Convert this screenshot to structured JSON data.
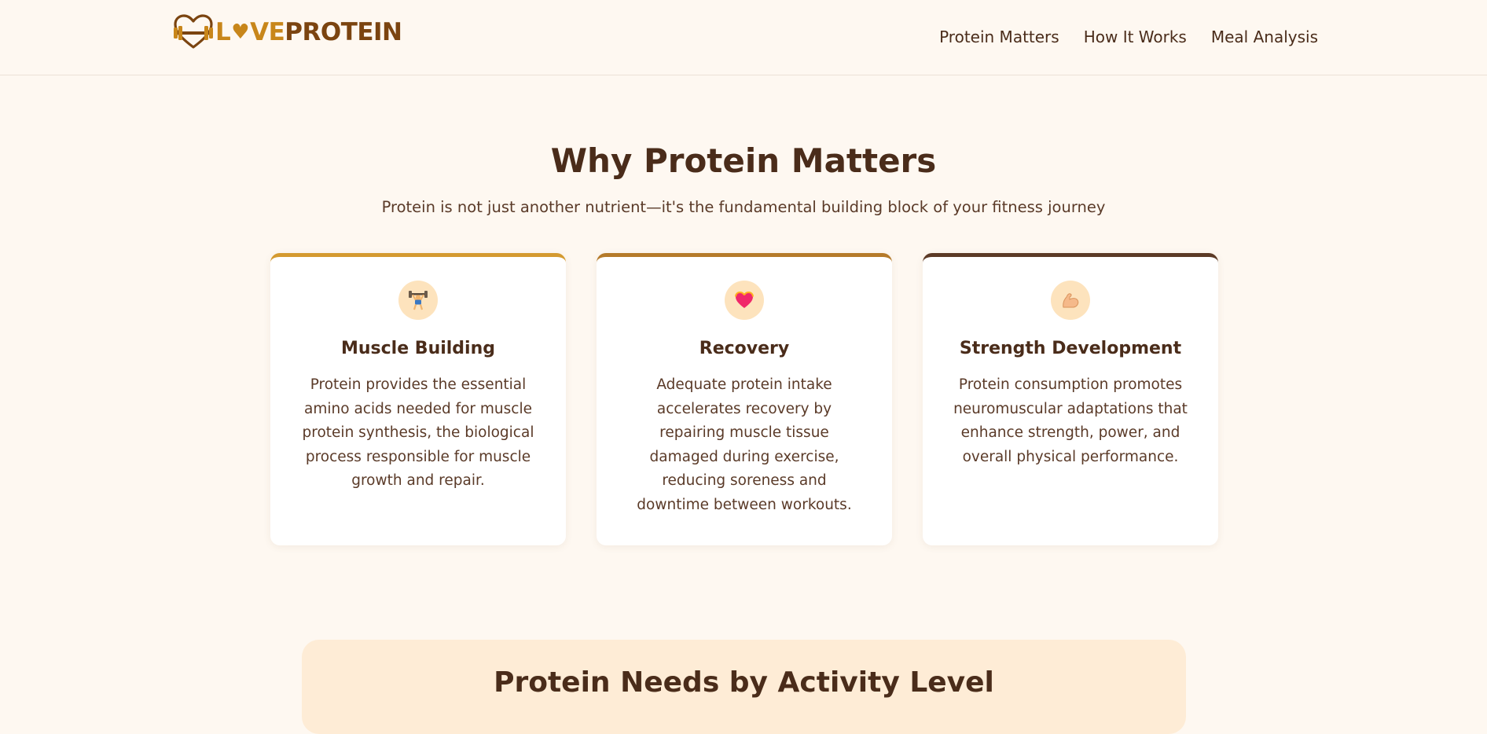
{
  "header": {
    "logo": {
      "icon": "heart-dumbbell-icon",
      "part_l": "L",
      "part_heart": "♥",
      "part_ve": "VE",
      "part_protein": "PROTEIN"
    },
    "nav": [
      {
        "label": "Protein Matters"
      },
      {
        "label": "How It Works"
      },
      {
        "label": "Meal Analysis"
      }
    ]
  },
  "section": {
    "title": "Why Protein Matters",
    "subtitle": "Protein is not just another nutrient—it's the fundamental building block of your fitness journey",
    "cards": [
      {
        "icon": "weightlifter-icon",
        "title": "Muscle Building",
        "body": "Protein provides the essential amino acids needed for muscle protein synthesis, the biological process responsible for muscle growth and repair."
      },
      {
        "icon": "heart-icon",
        "title": "Recovery",
        "body": "Adequate protein intake accelerates recovery by repairing muscle tissue damaged during exercise, reducing soreness and downtime between workouts."
      },
      {
        "icon": "flexed-biceps-icon",
        "title": "Strength Development",
        "body": "Protein consumption promotes neuromuscular adaptations that enhance strength, power, and overall physical performance."
      }
    ]
  },
  "activity": {
    "title": "Protein Needs by Activity Level"
  },
  "colors": {
    "background": "#fef8f1",
    "text": "#4a2c1a",
    "accent_gold": "#c8861a",
    "accent_brown": "#7b4410",
    "card_top_1": "#d49a30",
    "card_top_2": "#b57a2a",
    "card_top_3": "#5c3a26",
    "icon_circle": "#fde3bd",
    "panel": "#feecd6"
  }
}
